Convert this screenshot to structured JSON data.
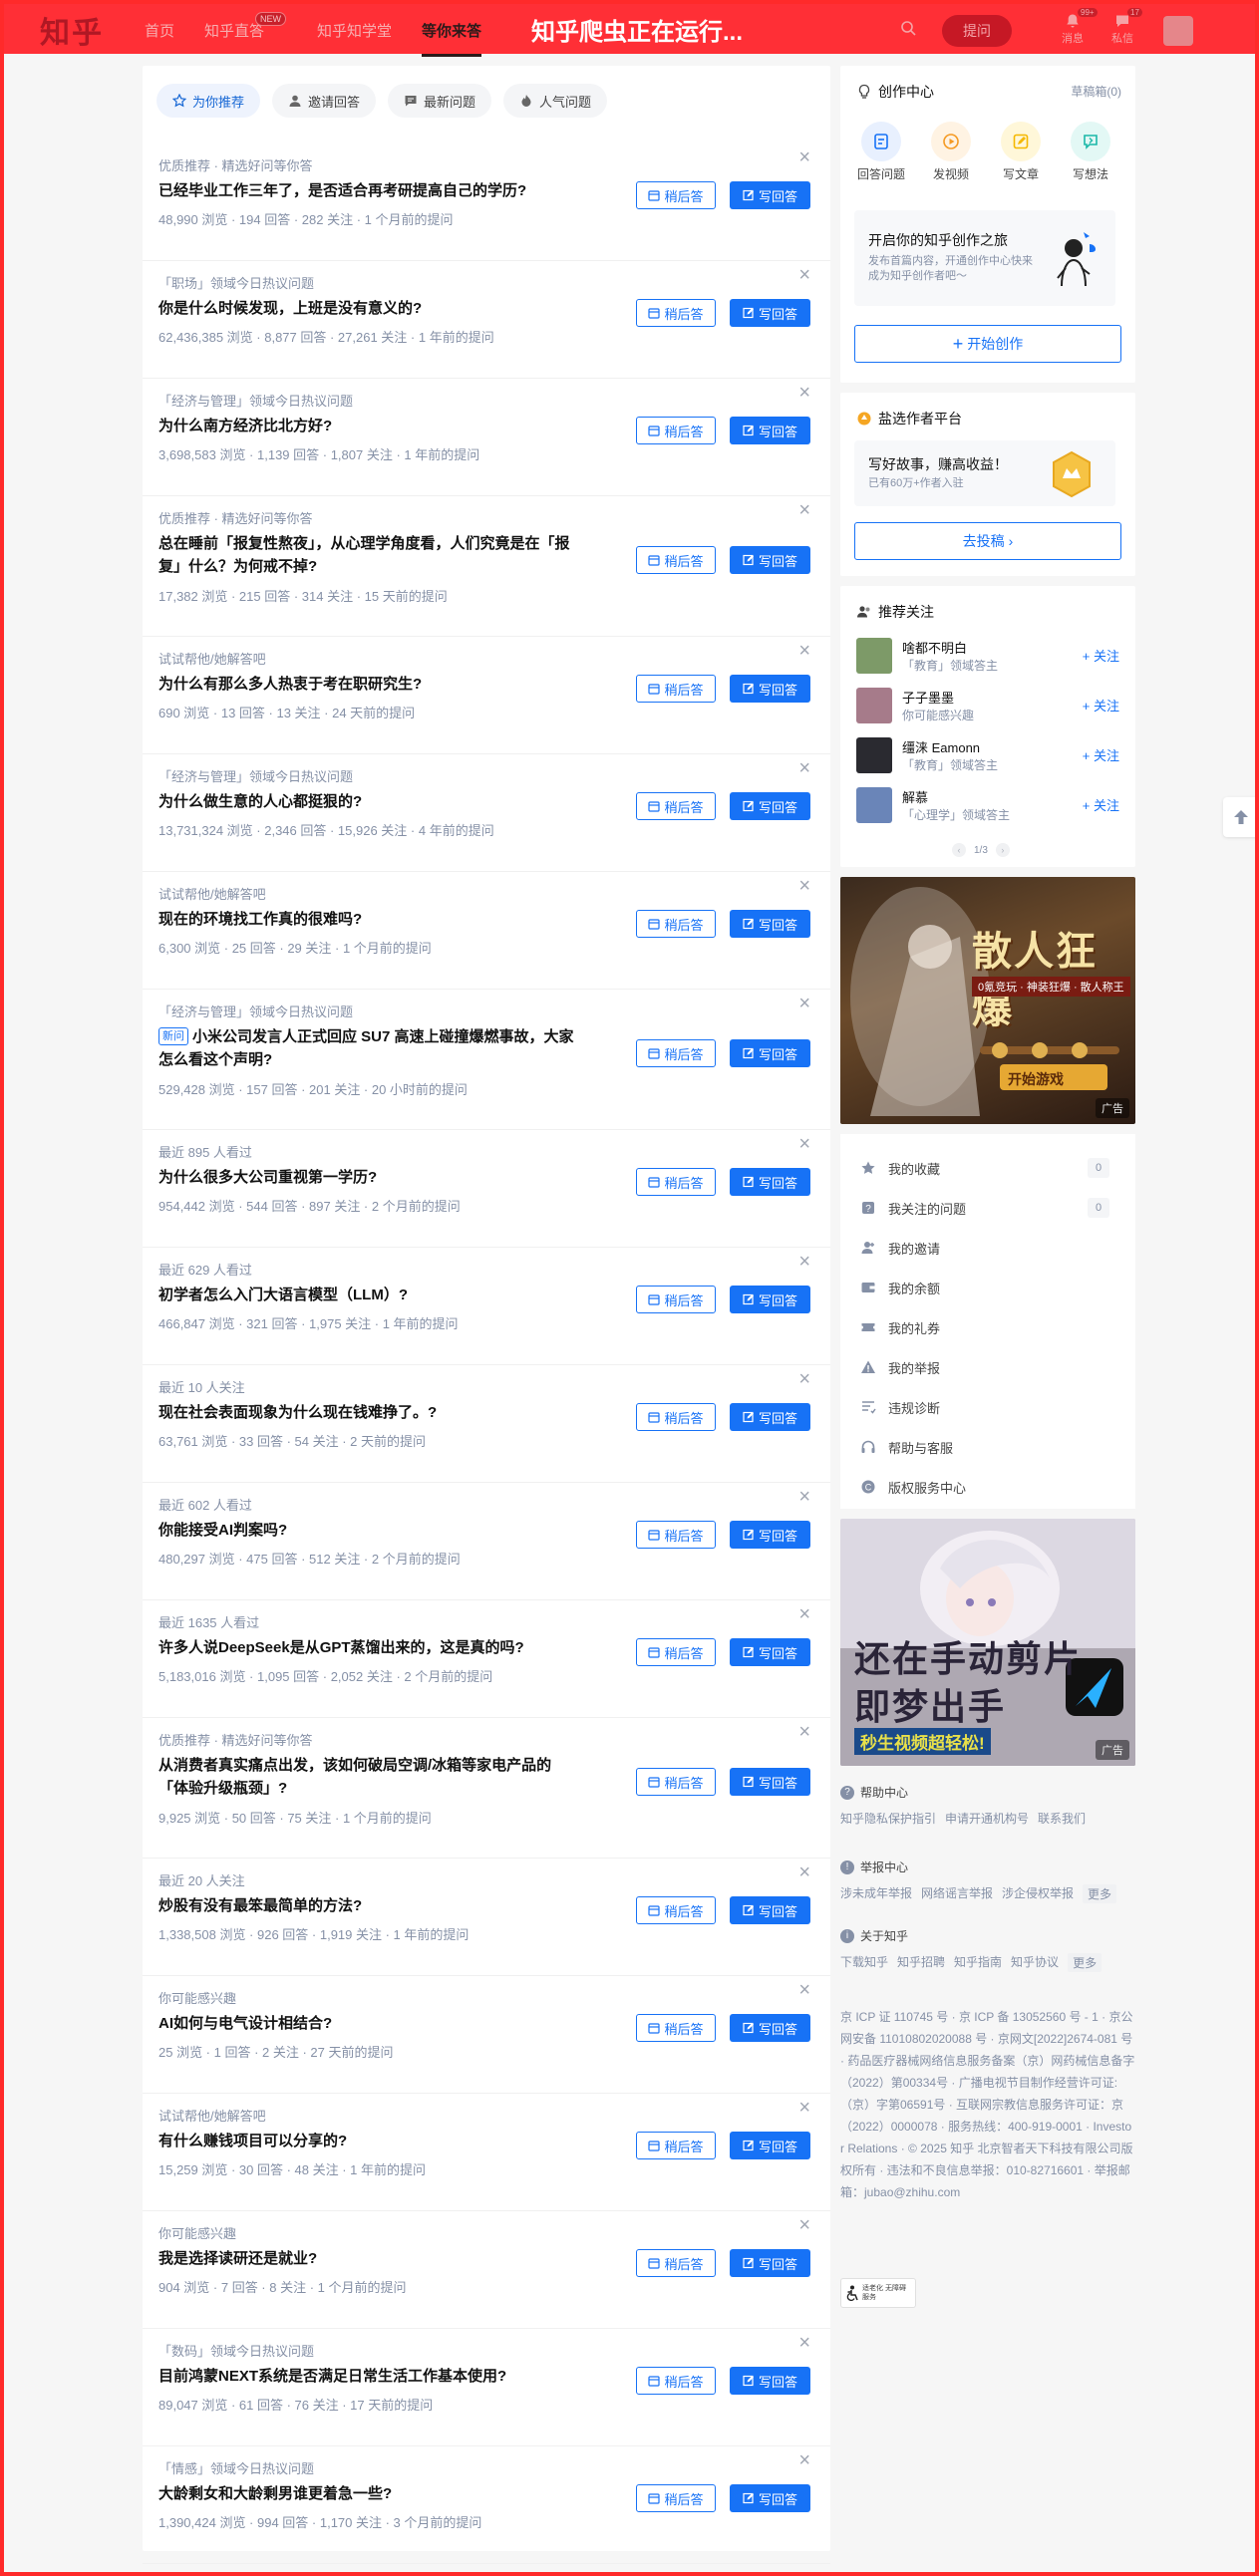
{
  "header": {
    "logo": "知乎",
    "nav": [
      {
        "label": "首页"
      },
      {
        "label": "知乎直答",
        "badge": "NEW"
      },
      {
        "label": "知乎知学堂"
      },
      {
        "label": "等你来答",
        "active": true
      }
    ],
    "banner": "知乎爬虫正在运行...",
    "ask_button": "提问",
    "notifications": {
      "label": "消息",
      "badge": "99+"
    },
    "messages": {
      "label": "私信",
      "badge": "17"
    },
    "accent_color": "#ff2f36"
  },
  "tabs": [
    {
      "label": "为你推荐",
      "icon": "star-icon",
      "active": true
    },
    {
      "label": "邀请回答",
      "icon": "person-icon"
    },
    {
      "label": "最新问题",
      "icon": "chat-icon"
    },
    {
      "label": "人气问题",
      "icon": "flame-icon"
    }
  ],
  "question_buttons": {
    "later": "稍后答",
    "answer": "写回答"
  },
  "questions": [
    {
      "source": "优质推荐 · 精选好问等你答",
      "title": "已经毕业工作三年了，是否适合再考研提高自己的学历?",
      "stats": "48,990 浏览 · 194 回答 · 282 关注 · 1 个月前的提问"
    },
    {
      "source": "「职场」领域今日热议问题",
      "title": "你是什么时候发现，上班是没有意义的?",
      "stats": "62,436,385 浏览 · 8,877 回答 · 27,261 关注 · 1 年前的提问"
    },
    {
      "source": "「经济与管理」领域今日热议问题",
      "title": "为什么南方经济比北方好?",
      "stats": "3,698,583 浏览 · 1,139 回答 · 1,807 关注 · 1 年前的提问"
    },
    {
      "source": "优质推荐 · 精选好问等你答",
      "title": "总在睡前「报复性熬夜」，从心理学角度看，人们究竟是在「报复」什么？为何戒不掉?",
      "stats": "17,382 浏览 · 215 回答 · 314 关注 · 15 天前的提问",
      "tall": true
    },
    {
      "source": "试试帮他/她解答吧",
      "title": "为什么有那么多人热衷于考在职研究生?",
      "stats": "690 浏览 · 13 回答 · 13 关注 · 24 天前的提问"
    },
    {
      "source": "「经济与管理」领域今日热议问题",
      "title": "为什么做生意的人心都挺狠的?",
      "stats": "13,731,324 浏览 · 2,346 回答 · 15,926 关注 · 4 年前的提问"
    },
    {
      "source": "试试帮他/她解答吧",
      "title": "现在的环境找工作真的很难吗?",
      "stats": "6,300 浏览 · 25 回答 · 29 关注 · 1 个月前的提问"
    },
    {
      "source": "「经济与管理」领域今日热议问题",
      "tag": "新问",
      "title": "小米公司发言人正式回应 SU7 高速上碰撞爆燃事故，大家怎么看这个声明?",
      "stats": "529,428 浏览 · 157 回答 · 201 关注 · 20 小时前的提问",
      "tall": true
    },
    {
      "source": "最近 895 人看过",
      "title": "为什么很多大公司重视第一学历?",
      "stats": "954,442 浏览 · 544 回答 · 897 关注 · 2 个月前的提问"
    },
    {
      "source": "最近 629 人看过",
      "title": "初学者怎么入门大语言模型（LLM）?",
      "stats": "466,847 浏览 · 321 回答 · 1,975 关注 · 1 年前的提问"
    },
    {
      "source": "最近 10 人关注",
      "title": "现在社会表面现象为什么现在钱难挣了。?",
      "stats": "63,761 浏览 · 33 回答 · 54 关注 · 2 天前的提问"
    },
    {
      "source": "最近 602 人看过",
      "title": "你能接受AI判案吗?",
      "stats": "480,297 浏览 · 475 回答 · 512 关注 · 2 个月前的提问"
    },
    {
      "source": "最近 1635 人看过",
      "title": "许多人说DeepSeek是从GPT蒸馏出来的，这是真的吗?",
      "stats": "5,183,016 浏览 · 1,095 回答 · 2,052 关注 · 2 个月前的提问"
    },
    {
      "source": "优质推荐 · 精选好问等你答",
      "title": "从消费者真实痛点出发，该如何破局空调/冰箱等家电产品的「体验升级瓶颈」?",
      "stats": "9,925 浏览 · 50 回答 · 75 关注 · 1 个月前的提问",
      "tall": true
    },
    {
      "source": "最近 20 人关注",
      "title": "炒股有没有最笨最简单的方法?",
      "stats": "1,338,508 浏览 · 926 回答 · 1,919 关注 · 1 年前的提问"
    },
    {
      "source": "你可能感兴趣",
      "title": "AI如何与电气设计相结合?",
      "stats": "25 浏览 · 1 回答 · 2 关注 · 27 天前的提问"
    },
    {
      "source": "试试帮他/她解答吧",
      "title": "有什么赚钱项目可以分享的?",
      "stats": "15,259 浏览 · 30 回答 · 48 关注 · 1 年前的提问"
    },
    {
      "source": "你可能感兴趣",
      "title": "我是选择读研还是就业?",
      "stats": "904 浏览 · 7 回答 · 8 关注 · 1 个月前的提问"
    },
    {
      "source": "「数码」领域今日热议问题",
      "title": "目前鸿蒙NEXT系统是否满足日常生活工作基本使用?",
      "stats": "89,047 浏览 · 61 回答 · 76 关注 · 17 天前的提问"
    },
    {
      "source": "「情感」领域今日热议问题",
      "title": "大龄剩女和大龄剩男谁更着急一些?",
      "stats": "1,390,424 浏览 · 994 回答 · 1,170 关注 · 3 个月前的提问"
    }
  ],
  "creator": {
    "title": "创作中心",
    "drafts": "草稿箱(0)",
    "actions": [
      {
        "label": "回答问题",
        "icon": "answer-icon",
        "color": "#1772f6",
        "bg": "#e8f0fe"
      },
      {
        "label": "发视频",
        "icon": "video-icon",
        "color": "#f59a23",
        "bg": "#fff3e3"
      },
      {
        "label": "写文章",
        "icon": "pen-icon",
        "color": "#f5b800",
        "bg": "#fff7d9"
      },
      {
        "label": "写想法",
        "icon": "idea-icon",
        "color": "#1bb7a8",
        "bg": "#e3f8f5"
      }
    ],
    "promo_title": "开启你的知乎创作之旅",
    "promo_sub": "发布首篇内容，开通创作中心快来成为知乎创作者吧～",
    "button": "开始创作"
  },
  "salt": {
    "title": "盐选作者平台",
    "promo_title": "写好故事，赚高收益！",
    "promo_sub": "已有60万+作者入驻",
    "button": "去投稿"
  },
  "recommend": {
    "title": "推荐关注",
    "follow_label": "关注",
    "users": [
      {
        "name": "啥都不明白",
        "desc": "「教育」领域答主",
        "color": "#7d9a68"
      },
      {
        "name": "子子墨墨",
        "desc": "你可能感兴趣",
        "color": "#a67b8a"
      },
      {
        "name": "缰涞 Eamonn",
        "desc": "「教育」领域答主",
        "color": "#2a2a30"
      },
      {
        "name": "解慕",
        "desc": "「心理学」领域答主",
        "color": "#6a85b8"
      }
    ],
    "pager": "1/3"
  },
  "ads": {
    "ad1_headline": "散人狂爆",
    "ad1_sub": "0氪竞玩 · 神装狂爆 · 散人称王",
    "ad1_cta": "开始游戏",
    "ad2_headline_1": "还在手动剪片",
    "ad2_headline_2": "即梦出手",
    "ad2_sub": "秒生视频超轻松!",
    "tag": "广告"
  },
  "menu": [
    {
      "label": "我的收藏",
      "icon": "star-icon",
      "count": "0"
    },
    {
      "label": "我关注的问题",
      "icon": "question-icon",
      "count": "0"
    },
    {
      "label": "我的邀请",
      "icon": "invite-icon"
    },
    {
      "label": "我的余额",
      "icon": "wallet-icon"
    },
    {
      "label": "我的礼券",
      "icon": "ticket-icon"
    },
    {
      "label": "我的举报",
      "icon": "warning-icon"
    },
    {
      "label": "违规诊断",
      "icon": "diagnose-icon"
    },
    {
      "label": "帮助与客服",
      "icon": "headset-icon"
    },
    {
      "label": "版权服务中心",
      "icon": "copyright-icon"
    }
  ],
  "footer": {
    "help": {
      "title": "帮助中心",
      "links": [
        "知乎隐私保护指引",
        "申请开通机构号",
        "联系我们"
      ]
    },
    "report": {
      "title": "举报中心",
      "links": [
        "涉未成年举报",
        "网络谣言举报",
        "涉企侵权举报"
      ],
      "more": "更多"
    },
    "about": {
      "title": "关于知乎",
      "links": [
        "下载知乎",
        "知乎招聘",
        "知乎指南",
        "知乎协议"
      ],
      "more": "更多"
    },
    "legal": "京 ICP 证 110745 号 · 京 ICP 备 13052560 号 - 1 · 京公网安备 11010802020088 号 · 京网文[2022]2674-081 号 · 药品医疗器械网络信息服务备案（京）网药械信息备字（2022）第00334号 · 广播电视节目制作经营许可证:（京）字第06591号 · 互联网宗教信息服务许可证：京（2022）0000078 · 服务热线：400-919-0001 · Investor Relations · © 2025 知乎 北京智者天下科技有限公司版权所有 · 违法和不良信息举报：010-82716601 · 举报邮箱：jubao@zhihu.com",
    "elder": "适老化 无障碍服务"
  }
}
